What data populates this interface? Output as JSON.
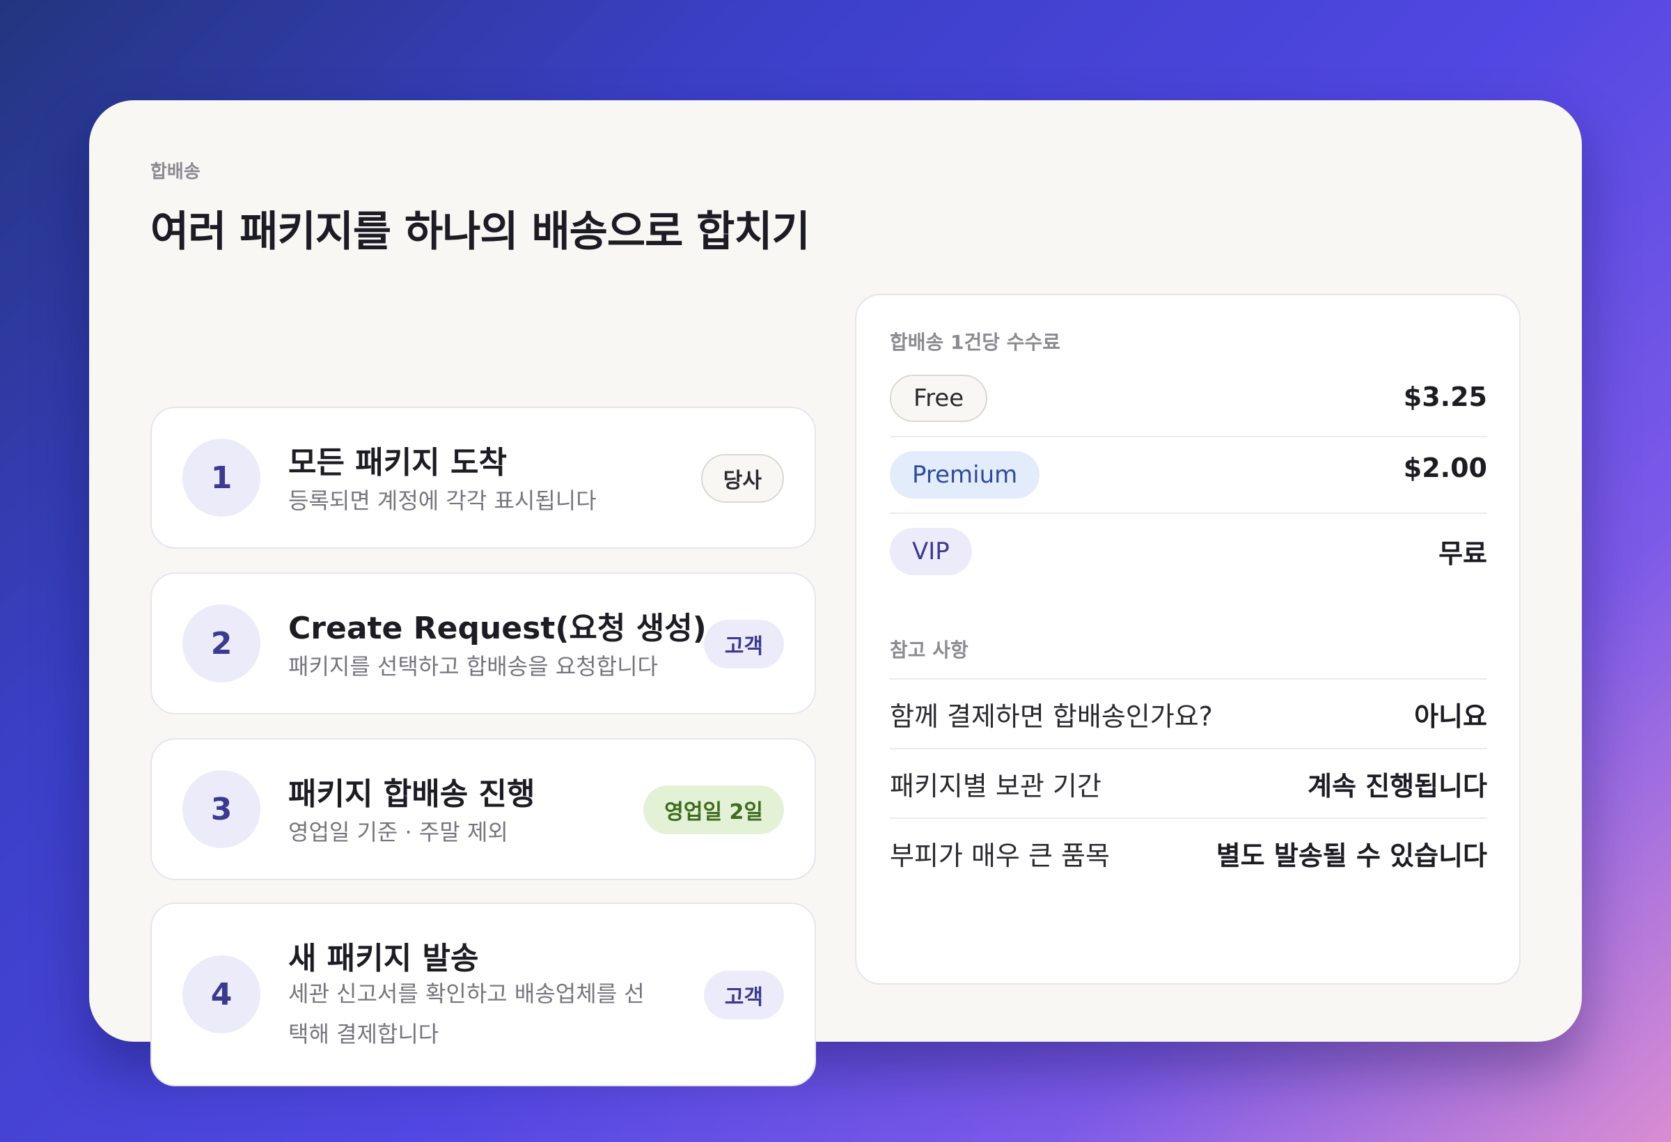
{
  "header": {
    "eyebrow": "합배송",
    "title": "여러 패키지를 하나의 배송으로 합치기"
  },
  "steps": [
    {
      "number": "1",
      "title": "모든 패키지 도착",
      "description": "등록되면 계정에 각각 표시됩니다",
      "badge": "당사"
    },
    {
      "number": "2",
      "title": "Create Request(요청 생성)",
      "description": "패키지를 선택하고 합배송을 요청합니다",
      "badge": "고객"
    },
    {
      "number": "3",
      "title": "패키지 합배송 진행",
      "description": "영업일 기준 · 주말 제외",
      "badge": "영업일 2일"
    },
    {
      "number": "4",
      "title": "새 패키지 발송",
      "description": "세관 신고서를 확인하고 배송업체를 선택해 결제합니다",
      "badge": "고객"
    }
  ],
  "fees": {
    "label": "합배송 1건당 수수료",
    "rows": [
      {
        "tier": "Free",
        "value": "$3.25"
      },
      {
        "tier": "Premium",
        "value": "$2.00"
      },
      {
        "tier": "VIP",
        "value": "무료"
      }
    ]
  },
  "notes": {
    "label": "참고 사항",
    "rows": [
      {
        "question": "함께 결제하면 합배송인가요?",
        "answer": "아니요"
      },
      {
        "question": "패키지별 보관 기간",
        "answer": "계속 진행됩니다"
      },
      {
        "question": "부피가 매우 큰 품목",
        "answer": "별도 발송될 수 있습니다"
      }
    ]
  }
}
